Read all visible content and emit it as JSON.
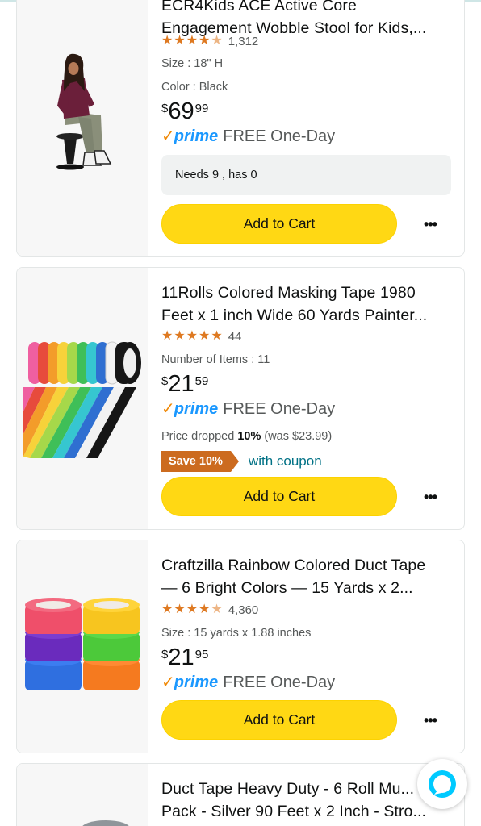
{
  "products": [
    {
      "title_lines": [
        "ECR4Kids ACE Active Core",
        "Engagement Wobble Stool for Kids,..."
      ],
      "rating_count": "1,312",
      "rating": 4.5,
      "meta": [
        "Size : 18\" H",
        "Color : Black"
      ],
      "price": {
        "currency": "$",
        "whole": "69",
        "fraction": "99"
      },
      "prime_label": "prime",
      "delivery": "FREE One-Day",
      "needs_text": "Needs 9 , has 0",
      "add_to_cart": "Add to Cart",
      "more_label": "•••"
    },
    {
      "title_lines": [
        "11Rolls Colored Masking Tape 1980",
        "Feet x 1 inch Wide 60 Yards Painter..."
      ],
      "rating_count": "44",
      "rating": 5,
      "meta": [
        "Number of Items : 11"
      ],
      "price": {
        "currency": "$",
        "whole": "21",
        "fraction": "59"
      },
      "prime_label": "prime",
      "delivery": "FREE One-Day",
      "price_drop": {
        "prefix": "Price dropped ",
        "percent": "10%",
        "suffix": " (was $23.99)"
      },
      "coupon": {
        "badge": "Save 10%",
        "text": "with coupon"
      },
      "add_to_cart": "Add to Cart",
      "more_label": "•••"
    },
    {
      "title_lines": [
        "Craftzilla Rainbow Colored Duct Tape",
        "— 6 Bright Colors — 15 Yards x 2..."
      ],
      "rating_count": "4,360",
      "rating": 4.5,
      "meta": [
        "Size : 15 yards x 1.88 inches"
      ],
      "price": {
        "currency": "$",
        "whole": "21",
        "fraction": "95"
      },
      "prime_label": "prime",
      "delivery": "FREE One-Day",
      "add_to_cart": "Add to Cart",
      "more_label": "•••"
    },
    {
      "title_lines": [
        "Duct Tape Heavy Duty - 6 Roll Mu...",
        "Pack - Silver 90 Feet x 2 Inch - Stro..."
      ]
    }
  ],
  "colors": {
    "star": "#de7921",
    "prime_blue": "#1a98ff",
    "cart_yellow": "#ffd814",
    "coupon_orange": "#cc6b1f",
    "link_teal": "#007185",
    "alexa_blue": "#00caff"
  },
  "icons": {
    "more": "ellipsis-icon",
    "alexa": "alexa-icon",
    "prime_check": "prime-check-icon"
  }
}
